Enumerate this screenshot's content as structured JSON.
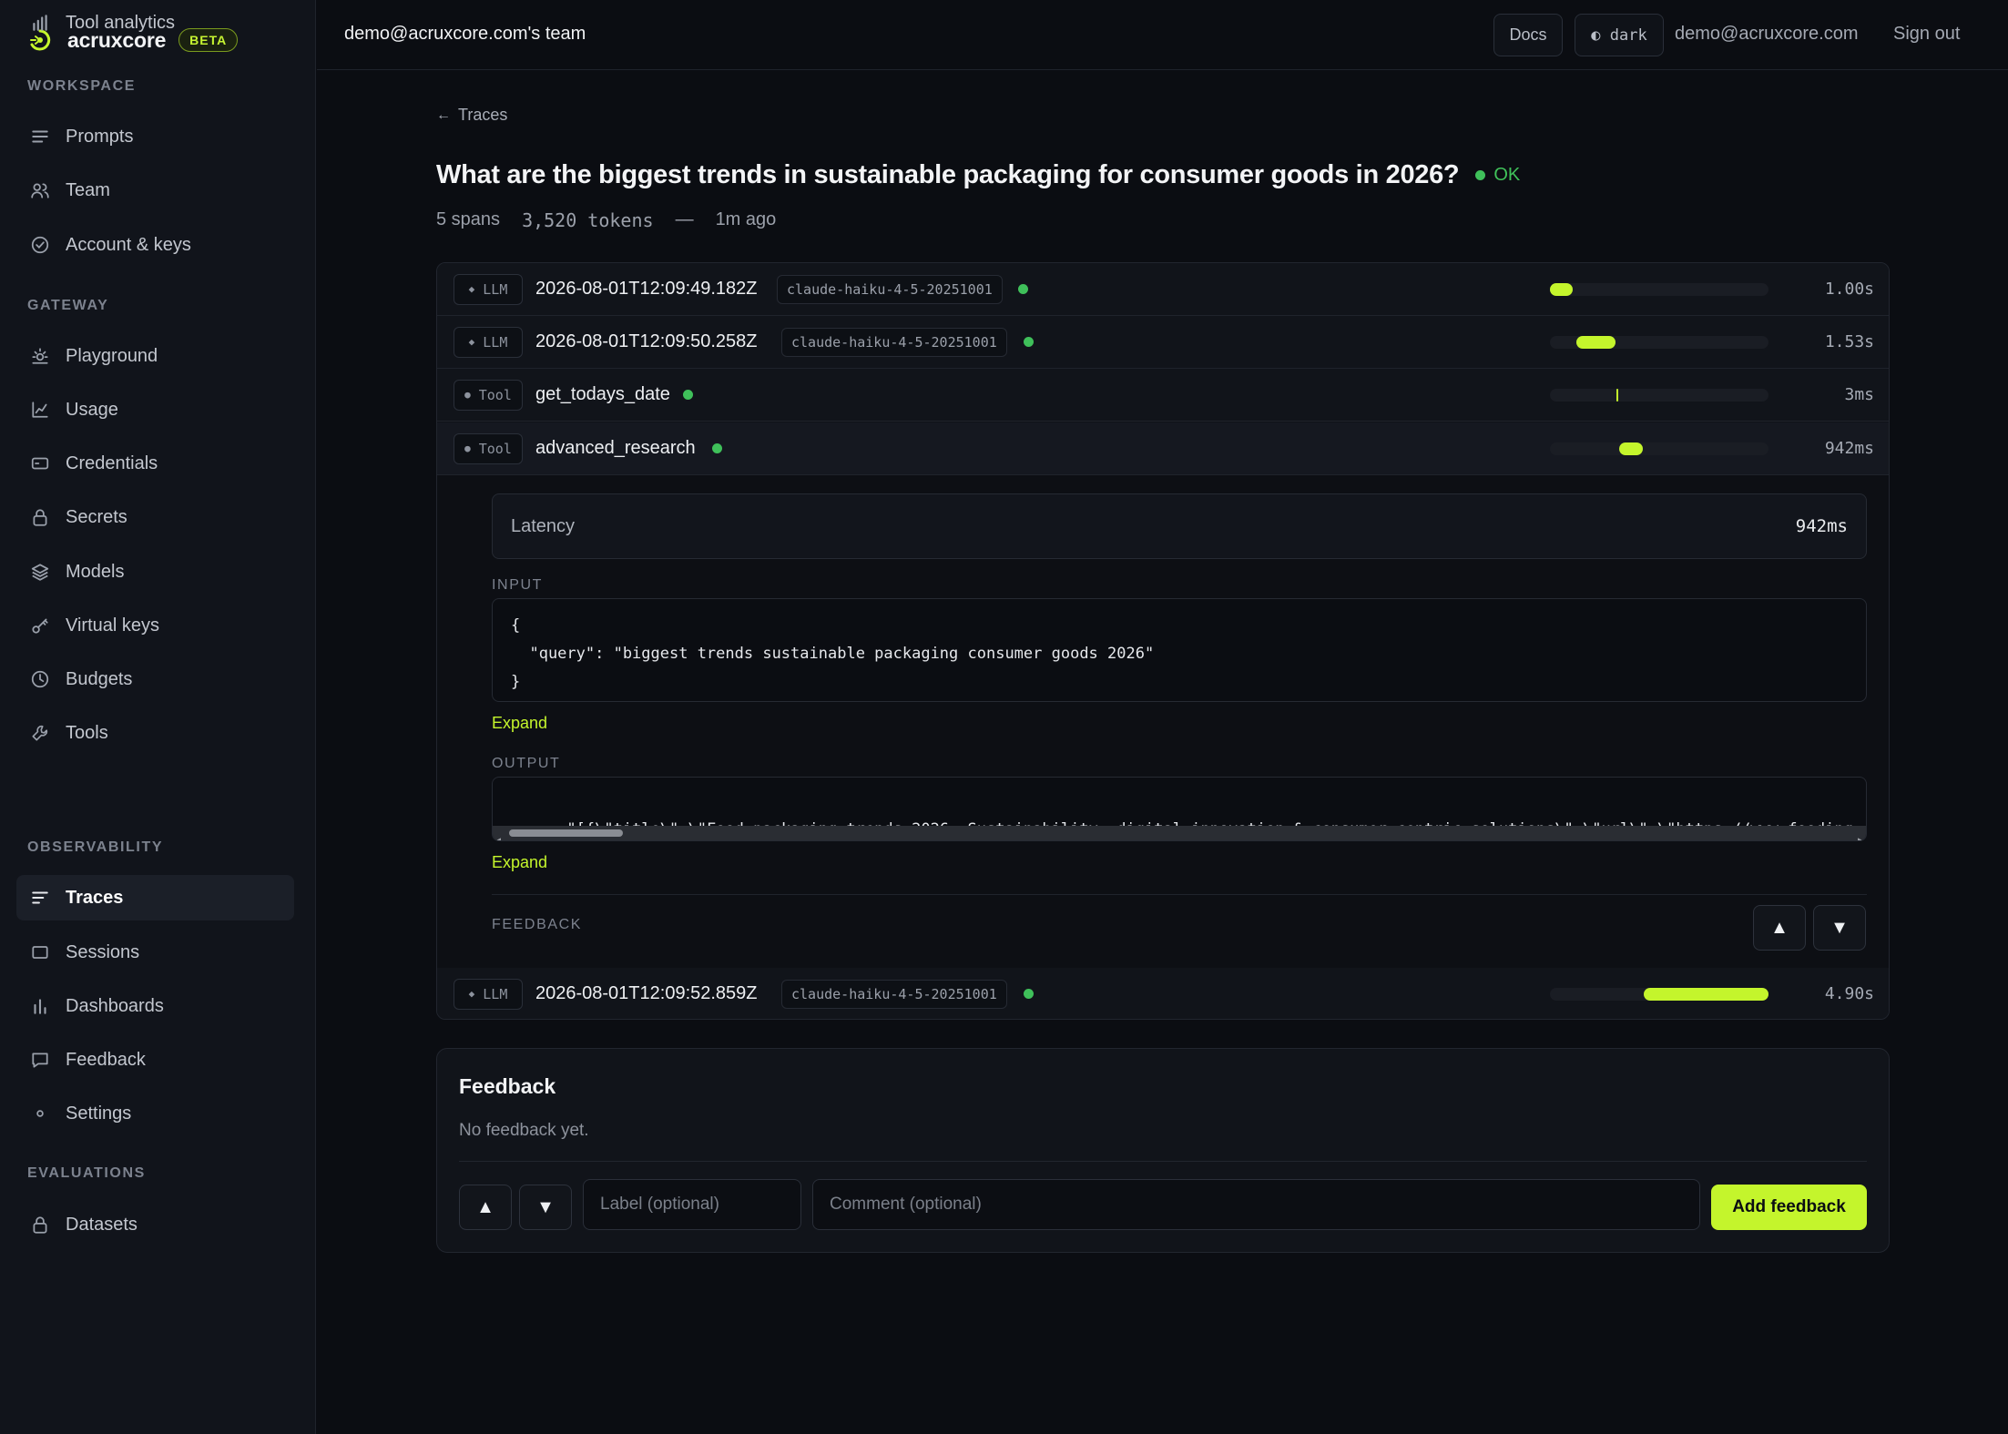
{
  "brand": {
    "name": "acruxcore",
    "badge": "BETA",
    "accent": "#c4f52c"
  },
  "sidebar": {
    "sections": [
      {
        "title": "WORKSPACE",
        "items": [
          {
            "label": "Prompts",
            "icon": "lines-icon"
          },
          {
            "label": "Team",
            "icon": "users-icon"
          },
          {
            "label": "Account & keys",
            "icon": "check-circle-icon"
          }
        ]
      },
      {
        "title": "GATEWAY",
        "items": [
          {
            "label": "Playground",
            "icon": "sun-icon"
          },
          {
            "label": "Usage",
            "icon": "line-chart-icon"
          },
          {
            "label": "Credentials",
            "icon": "card-icon"
          },
          {
            "label": "Secrets",
            "icon": "lock-icon"
          },
          {
            "label": "Models",
            "icon": "layers-icon"
          },
          {
            "label": "Virtual keys",
            "icon": "key-icon"
          },
          {
            "label": "Budgets",
            "icon": "clock-icon"
          },
          {
            "label": "Tools",
            "icon": "wrench-icon"
          },
          {
            "label": "Tool analytics",
            "icon": "bar-chart-icon"
          }
        ]
      },
      {
        "title": "OBSERVABILITY",
        "items": [
          {
            "label": "Traces",
            "icon": "list-icon",
            "active": true
          },
          {
            "label": "Sessions",
            "icon": "square-icon"
          },
          {
            "label": "Dashboards",
            "icon": "bars-icon"
          },
          {
            "label": "Feedback",
            "icon": "message-icon"
          },
          {
            "label": "Settings",
            "icon": "dot-icon"
          }
        ]
      },
      {
        "title": "EVALUATIONS",
        "items": [
          {
            "label": "Datasets",
            "icon": "lock-icon"
          }
        ]
      }
    ]
  },
  "header": {
    "team": "demo@acruxcore.com's team",
    "docs": "Docs",
    "theme": "◐ dark",
    "email": "demo@acruxcore.com",
    "signout": "Sign out"
  },
  "trace": {
    "back": "Traces",
    "title": "What are the biggest trends in sustainable packaging for consumer goods in 2026?",
    "status": "OK",
    "spans_count": "5 spans",
    "tokens": "3,520 tokens",
    "sep": "—",
    "ago": "1m ago",
    "spans": [
      {
        "kind": "LLM",
        "sym": "◆",
        "name": "2026-08-01T12:09:49.182Z",
        "model": "claude-haiku-4-5-20251001",
        "start": 0.0,
        "width": 0.105,
        "duration": "1.00s"
      },
      {
        "kind": "LLM",
        "sym": "◆",
        "name": "2026-08-01T12:09:50.258Z",
        "model": "claude-haiku-4-5-20251001",
        "start": 0.12,
        "width": 0.18,
        "duration": "1.53s"
      },
      {
        "kind": "Tool",
        "sym": "●",
        "name": "get_todays_date",
        "model": "",
        "start": 0.305,
        "width": 0.006,
        "duration": "3ms"
      },
      {
        "kind": "Tool",
        "sym": "●",
        "name": "advanced_research",
        "model": "",
        "start": 0.315,
        "width": 0.11,
        "duration": "942ms"
      },
      {
        "kind": "LLM",
        "sym": "◆",
        "name": "2026-08-01T12:09:52.859Z",
        "model": "claude-haiku-4-5-20251001",
        "start": 0.43,
        "width": 0.57,
        "duration": "4.90s"
      }
    ],
    "detail": {
      "latency_label": "Latency",
      "latency_value": "942ms",
      "input_label": "INPUT",
      "input_code": "{\n  \"query\": \"biggest trends sustainable packaging consumer goods 2026\"\n}",
      "output_label": "OUTPUT",
      "output_code": "\"[{\\\"title\\\":\\\"Food packaging trends 2026: Sustainability, digital innovation & consumer-centric solutions\\\",\\\"url\\\":\\\"https://www.fooding",
      "expand": "Expand",
      "feedback_label": "FEEDBACK"
    }
  },
  "feedback": {
    "title": "Feedback",
    "empty": "No feedback yet.",
    "label_placeholder": "Label (optional)",
    "comment_placeholder": "Comment (optional)",
    "add": "Add feedback"
  }
}
